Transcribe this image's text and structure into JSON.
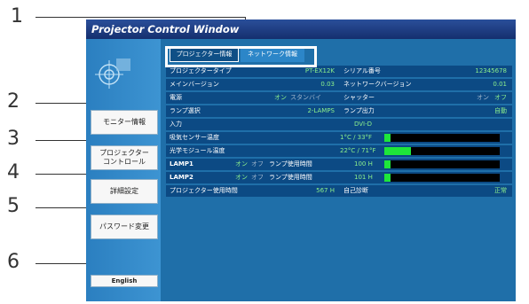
{
  "window": {
    "title": "Projector Control Window"
  },
  "callouts": [
    "1",
    "2",
    "3",
    "4",
    "5",
    "6"
  ],
  "sidebar": {
    "items": [
      {
        "label": "モニター情報"
      },
      {
        "label": "プロジェクター\nコントロール"
      },
      {
        "label": "詳細設定"
      },
      {
        "label": "パスワード変更"
      },
      {
        "label": "English"
      }
    ]
  },
  "tabs": [
    {
      "label": "プロジェクター情報"
    },
    {
      "label": "ネットワーク情報"
    }
  ],
  "rows": [
    {
      "l1": "プロジェクタータイプ",
      "v1": "PT-EX12K",
      "l2": "シリアル番号",
      "v2": "12345678"
    },
    {
      "l1": "メインバージョン",
      "v1": "0.03",
      "l2": "ネットワークバージョン",
      "v2": "0.01"
    },
    {
      "l1": "電源",
      "v1a": "オン",
      "v1b": "スタンバイ",
      "l2": "シャッター",
      "v2a": "オン",
      "v2b": "オフ"
    },
    {
      "l1": "ランプ選択",
      "v1": "2-LAMPS",
      "l2": "ランプ出力",
      "v2": "自動"
    },
    {
      "l1": "入力",
      "v1": "DVI-D"
    },
    {
      "l1": "吸気センサー温度",
      "v1": "1°C / 33°F",
      "level": 0.05
    },
    {
      "l1": "光学モジュール温度",
      "v1": "22°C / 71°F",
      "level": 0.23
    },
    {
      "l1": "LAMP1",
      "onoff_a": "オン",
      "onoff_b": "オフ",
      "lamp_label": "ランプ使用時間",
      "hours": "100 H",
      "level": 0.05
    },
    {
      "l1": "LAMP2",
      "onoff_a": "オン",
      "onoff_b": "オフ",
      "lamp_label": "ランプ使用時間",
      "hours": "101 H",
      "level": 0.05
    },
    {
      "l1": "プロジェクター使用時間",
      "v1": "567 H",
      "l2": "自己診断",
      "v2": "正常"
    }
  ]
}
